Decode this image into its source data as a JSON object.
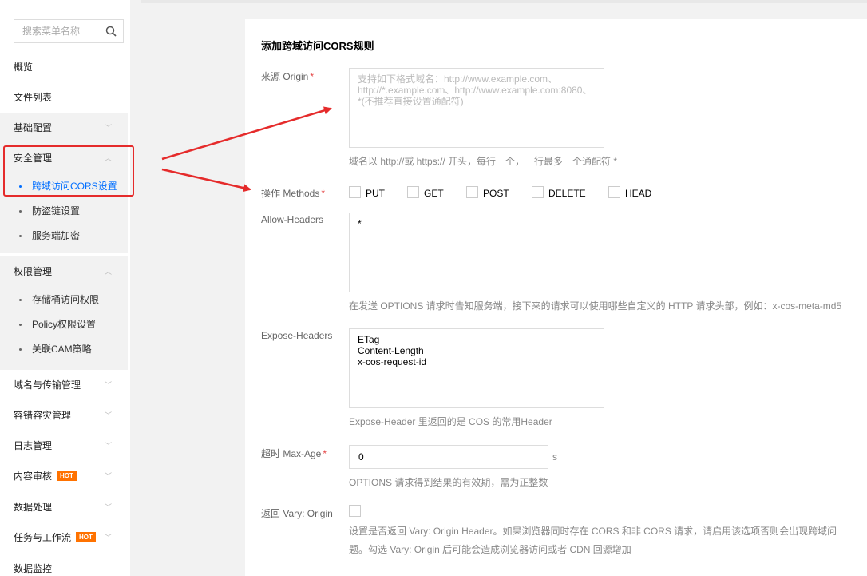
{
  "sidebar": {
    "search_placeholder": "搜索菜单名称",
    "items": {
      "overview": "概览",
      "file_list": "文件列表",
      "basic_config": "基础配置",
      "security": "安全管理",
      "cors": "跨域访问CORS设置",
      "hotlink": "防盗链设置",
      "server_encrypt": "服务端加密",
      "permission": "权限管理",
      "bucket_acl": "存储桶访问权限",
      "policy": "Policy权限设置",
      "cam": "关联CAM策略",
      "domain": "域名与传输管理",
      "disaster": "容错容灾管理",
      "log": "日志管理",
      "content_audit": "内容审核",
      "data_process": "数据处理",
      "workflow": "任务与工作流",
      "monitor": "数据监控"
    },
    "hot_badge": "HOT"
  },
  "form": {
    "title": "添加跨域访问CORS规则",
    "origin": {
      "label": "来源 Origin",
      "required_mark": "*",
      "placeholder": "支持如下格式域名：http://www.example.com、\nhttp://*.example.com、http://www.example.com:8080、\n*(不推荐直接设置通配符)",
      "hint": "域名以 http://或 https:// 开头，每行一个，一行最多一个通配符 *"
    },
    "methods": {
      "label": "操作 Methods",
      "required_mark": "*",
      "options": [
        "PUT",
        "GET",
        "POST",
        "DELETE",
        "HEAD"
      ]
    },
    "allow_headers": {
      "label": "Allow-Headers",
      "value": "*",
      "hint": "在发送 OPTIONS 请求时告知服务端，接下来的请求可以使用哪些自定义的 HTTP 请求头部，例如：x-cos-meta-md5"
    },
    "expose_headers": {
      "label": "Expose-Headers",
      "value": "ETag\nContent-Length\nx-cos-request-id",
      "hint": "Expose-Header 里返回的是 COS 的常用Header"
    },
    "max_age": {
      "label": "超时 Max-Age",
      "required_mark": "*",
      "value": "0",
      "unit": "s",
      "hint": "OPTIONS 请求得到结果的有效期，需为正整数"
    },
    "vary": {
      "label": "返回 Vary: Origin",
      "hint_line1": "设置是否返回 Vary: Origin Header。如果浏览器同时存在 CORS 和非 CORS 请求，请启用该选项否则会出现跨域问",
      "hint_line2": "题。勾选 Vary: Origin 后可能会造成浏览器访问或者 CDN 回源增加"
    }
  },
  "colors": {
    "accent": "#006eff",
    "highlight_red": "#e52b2b",
    "hot": "#ff7200"
  }
}
